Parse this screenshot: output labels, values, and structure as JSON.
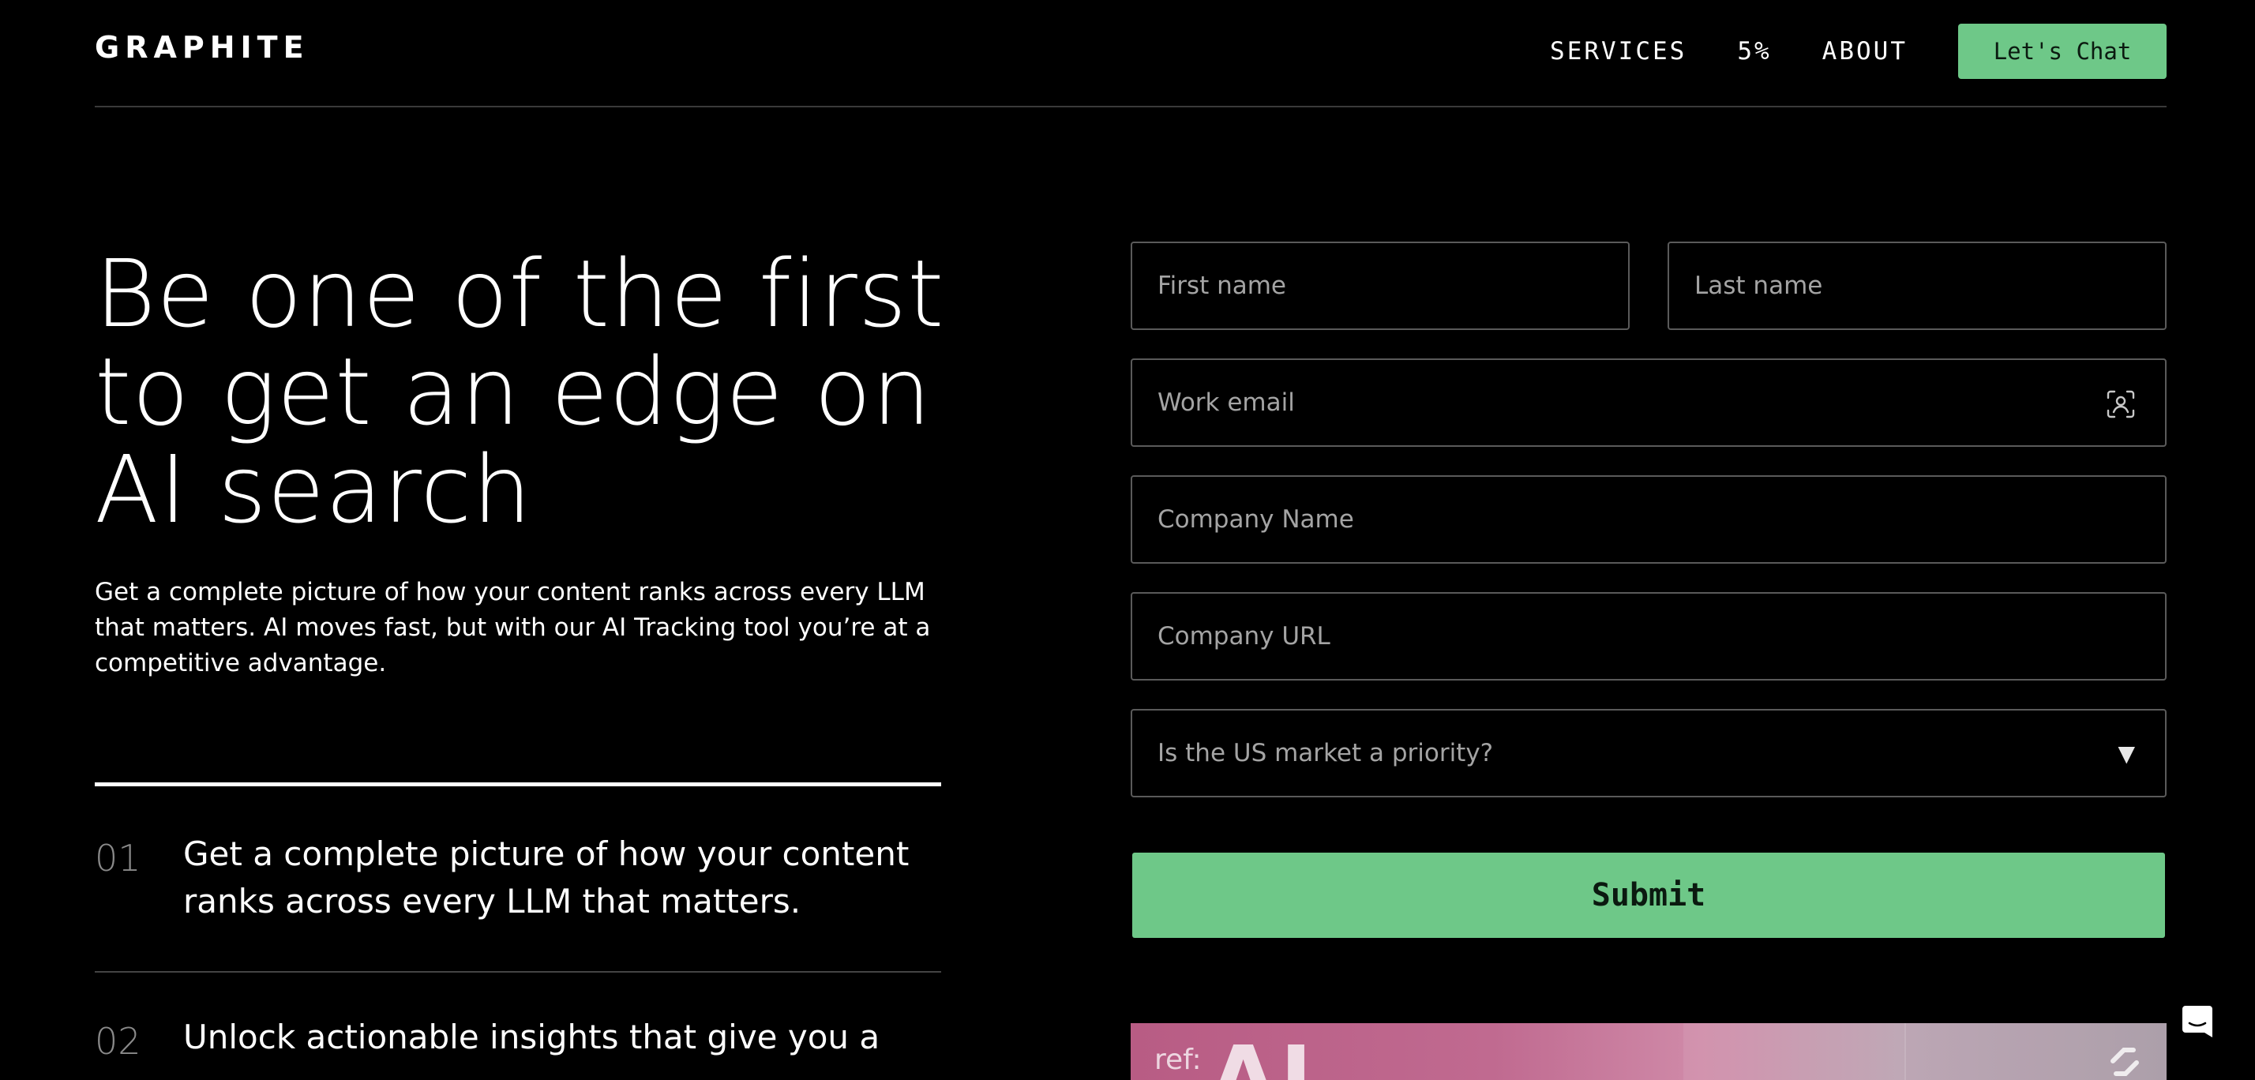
{
  "header": {
    "logo": "GRAPHITE",
    "nav": {
      "services": "SERVICES",
      "percent": "5%",
      "about": "ABOUT"
    },
    "cta_label": "Let's Chat"
  },
  "hero": {
    "title": "Be one of the first to get an edge on AI search",
    "subtitle": "Get a complete picture of how your content ranks across every LLM that matters. AI moves fast, but with our AI Tracking tool you’re at a competitive advantage."
  },
  "features": [
    {
      "num": "01",
      "text": "Get a complete picture of how your content ranks across every LLM that matters."
    },
    {
      "num": "02",
      "text": "Unlock actionable insights that give you a"
    }
  ],
  "form": {
    "first_name_placeholder": "First name",
    "last_name_placeholder": "Last name",
    "email_placeholder": "Work email",
    "company_name_placeholder": "Company Name",
    "company_url_placeholder": "Company URL",
    "us_market_placeholder": "Is the US market a priority?",
    "submit_label": "Submit"
  },
  "banner": {
    "ref_label": "ref:",
    "headline": "AI"
  },
  "colors": {
    "accent": "#6ec888",
    "background": "#000000",
    "field_border": "#5a5a5a"
  },
  "icons": {
    "email_field": "contact-autofill-icon",
    "select": "dropdown-triangle-icon",
    "chat": "chat-bubble-icon",
    "banner_mark": "graphite-mark-icon"
  }
}
